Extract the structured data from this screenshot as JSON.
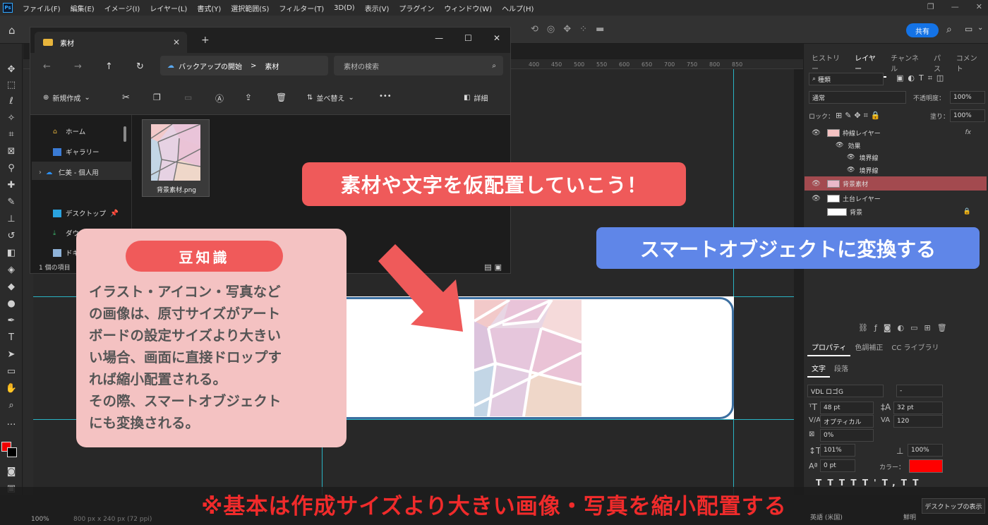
{
  "menu": {
    "items": [
      "ファイル(F)",
      "編集(E)",
      "イメージ(I)",
      "レイヤー(L)",
      "書式(Y)",
      "選択範囲(S)",
      "フィルター(T)",
      "3D(D)",
      "表示(V)",
      "プラグイン",
      "ウィンドウ(W)",
      "ヘルプ(H)"
    ],
    "logo": "Ps"
  },
  "options_bar": {
    "share_label": "共有"
  },
  "ruler": {
    "ticks": [
      "400",
      "450",
      "500",
      "550",
      "600",
      "650",
      "700",
      "750",
      "800",
      "850"
    ]
  },
  "explorer": {
    "tab_title": "素材",
    "new_tab": "+",
    "breadcrumb": [
      "バックアップの開始",
      "素材"
    ],
    "breadcrumb_sep": ">",
    "search_placeholder": "素材の検索",
    "commands": {
      "new": "新規作成",
      "sort": "並べ替え",
      "more": "•••",
      "details": "詳細"
    },
    "nav": [
      {
        "label": "ホーム",
        "icon": "home-icon"
      },
      {
        "label": "ギャラリー",
        "icon": "gallery-icon"
      },
      {
        "label": "仁美 - 個人用",
        "icon": "onedrive-icon"
      },
      {
        "label": "デスクトップ",
        "icon": "desktop-icon"
      },
      {
        "label": "ダウン",
        "icon": "download-icon"
      },
      {
        "label": "ドキ",
        "icon": "documents-icon"
      }
    ],
    "file": {
      "name": "背景素材.png"
    },
    "status": "1 個の項目"
  },
  "panels": {
    "tabs_top": [
      "ヒストリー",
      "レイヤー",
      "チャンネル",
      "パス",
      "コメント"
    ],
    "filter_kind": "種類",
    "blend_mode": "通常",
    "opacity_label": "不透明度：",
    "opacity_value": "100%",
    "lock_label": "ロック：",
    "fill_label": "塗り：",
    "fill_value": "100%",
    "layers": [
      {
        "name": "枠線レイヤー",
        "fx": "fx"
      },
      {
        "name": "効果"
      },
      {
        "name": "境界線"
      },
      {
        "name": "境界線"
      },
      {
        "name": "背景素材"
      },
      {
        "name": "土台レイヤー"
      },
      {
        "name": "背景"
      }
    ],
    "tabs_mid": [
      "プロパティ",
      "色調補正",
      "CC ライブラリ"
    ],
    "tabs_char": [
      "文字",
      "段落"
    ],
    "char": {
      "font": "VDL ロゴG",
      "style": "-",
      "size": "48 pt",
      "leading": "32 pt",
      "kerning": "オプティカル",
      "tracking": "120",
      "tsume": "0%",
      "vscale": "101%",
      "hscale": "100%",
      "baseline": "0 pt",
      "color_label": "カラー：",
      "color": "#ff0000",
      "lang": "英語 (米国)",
      "aa": "鮮明"
    }
  },
  "overlays": {
    "callout_top": "素材や文字を仮配置していこう！",
    "callout_blue": "スマートオブジェクトに変換する",
    "tip_title": "豆知識",
    "tip_lines": [
      "イラスト・アイコン・写真など",
      "の画像は、原寸サイズがアート",
      "ボードの設定サイズより大きい",
      "い場合、画面に直接ドロップす",
      "れば縮小配置される。",
      "その際、スマートオブジェクト",
      "にも変換される。"
    ],
    "bottom_banner": "※基本は作成サイズより大きい画像・写真を縮小配置する"
  },
  "status_bar": {
    "zoom": "100%",
    "doc": "800 px x 240 px (72 ppi)"
  },
  "taskbar": {
    "desktop_tip": "デスクトップの表示"
  },
  "colors": {
    "accent_red": "#ef5a5a",
    "accent_blue": "#5f86e8",
    "banner_red": "#f02b2b",
    "selected_layer": "#a34a4f"
  }
}
